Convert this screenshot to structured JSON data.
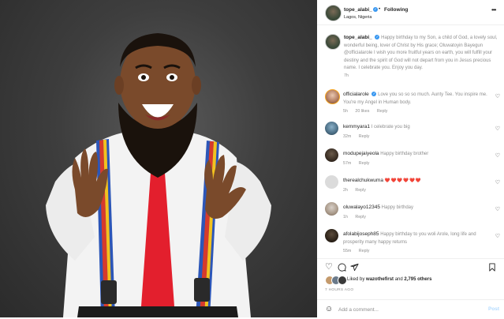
{
  "post": {
    "author": "tope_alabi_",
    "follow_dot": "•",
    "follow_label": "Following",
    "location": "Lagos, Nigeria",
    "more_icon": "more-horizontal-icon",
    "photo_description_icon": "photo"
  },
  "caption": {
    "username": "tope_alabi_",
    "text": "Happy birthday to my Son, a child of God, a lovely soul, wonderful being, lover of Christ by His grace; Oluwatoyin Bayegun @officialarole I wish you more fruitful years on earth, you will fulfill your destiny and the spirit of God will not depart from you in Jesus precious name. I celebrate you. Enjoy you day.",
    "time": "7h"
  },
  "comments": [
    {
      "username": "officialarole",
      "verified": true,
      "text": "Love you so so so much. Aunty Tee. You inspire me. You're my Angel in Human body.",
      "time": "5h",
      "likes": "20 likes",
      "reply": "Reply"
    },
    {
      "username": "kemmyara1",
      "verified": false,
      "text": "I celebrate you big",
      "time": "32m",
      "likes": "",
      "reply": "Reply"
    },
    {
      "username": "modupejaiyeola",
      "verified": false,
      "text": "Happy birthday brother",
      "time": "57m",
      "likes": "",
      "reply": "Reply"
    },
    {
      "username": "therealchukwuma",
      "verified": false,
      "text": "❤️❤️❤️❤️❤️❤️",
      "time": "2h",
      "likes": "",
      "reply": "Reply"
    },
    {
      "username": "oluwalayo12345",
      "verified": false,
      "text": "Happy birthday",
      "time": "1h",
      "likes": "",
      "reply": "Reply"
    },
    {
      "username": "afolabijoseph85",
      "verified": false,
      "text": "Happy birthday to you woli Arole, long life and prosperity many happy returns",
      "time": "55m",
      "likes": "",
      "reply": "Reply"
    }
  ],
  "likes": {
    "liked_by": "Liked by",
    "user": "wazothefirst",
    "and": "and",
    "others": "2,795 others"
  },
  "timestamp": "7 HOURS AGO",
  "add_comment": {
    "placeholder": "Add a comment...",
    "post_label": "Post"
  },
  "colors": {
    "verified": "#3897f0",
    "post_disabled": "#b3dbff",
    "secondary_text": "#8e8e8e",
    "primary_text": "#262626"
  }
}
